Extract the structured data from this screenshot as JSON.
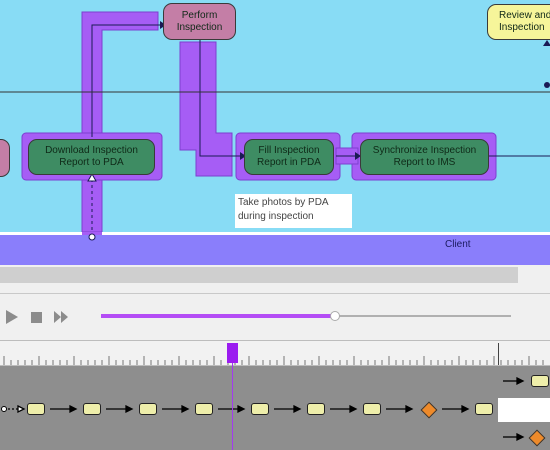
{
  "diagram": {
    "nodes": {
      "perform_inspection": "Perform Inspection",
      "review_inspection": "Review and Inspection",
      "download_report": "Download Inspection Report to PDA",
      "fill_report": "Fill Inspection Report in PDA",
      "synchronize_report": "Synchronize Inspection Report to IMS"
    },
    "note": "Take photos by PDA during inspection",
    "lane_label": "Client"
  },
  "player": {
    "play_icon": "play-icon",
    "stop_icon": "stop-icon",
    "forward_icon": "fast-forward-icon",
    "progress_fraction": 0.57
  },
  "colors": {
    "canvas": "#88dcf5",
    "task_green": "#3e8c63",
    "task_pink": "#c47ea6",
    "task_yellow": "#f6f59a",
    "highlight_purple": "#a65df5",
    "lane_band": "#8a7efb",
    "playhead": "#9b1cf0",
    "decision_orange": "#ee8a2a"
  }
}
